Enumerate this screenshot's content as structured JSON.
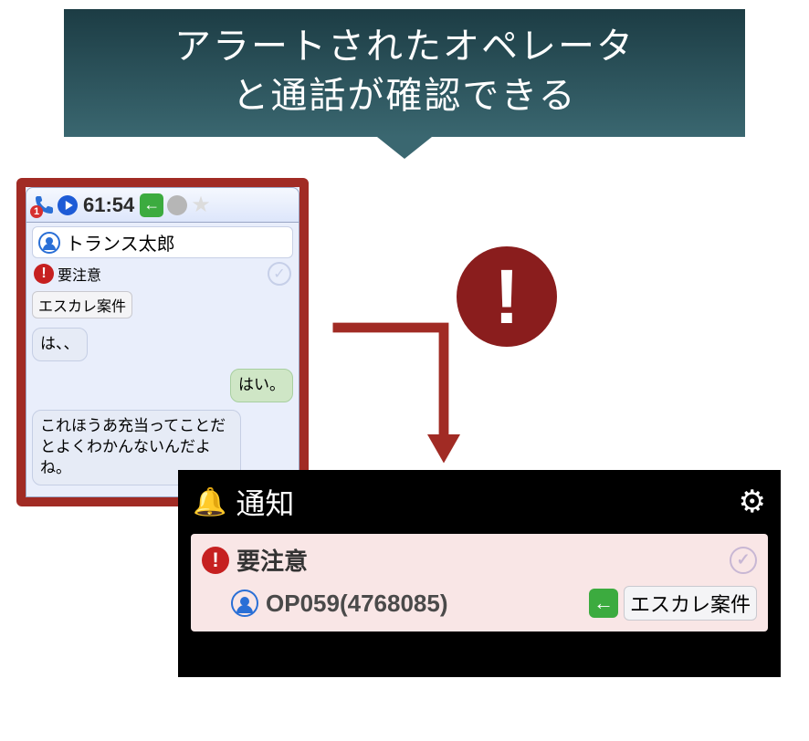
{
  "banner": {
    "line1": "アラートされたオペレータ",
    "line2": "と通話が確認できる"
  },
  "chat": {
    "header": {
      "phone_badge": "1",
      "timer": "61:54"
    },
    "operator_name": "トランス太郎",
    "alert_label": "要注意",
    "escal_tag": "エスカレ案件",
    "messages": {
      "left1": "は、、",
      "right1": "はい。",
      "left2": "これほうあ充当ってことだとよくわかんないんだよね。"
    }
  },
  "big_alert": {
    "symbol": "!"
  },
  "notif": {
    "title": "通知",
    "card": {
      "alert_label": "要注意",
      "operator": "OP059(4768085)",
      "escal_tag": "エスカレ案件"
    }
  }
}
